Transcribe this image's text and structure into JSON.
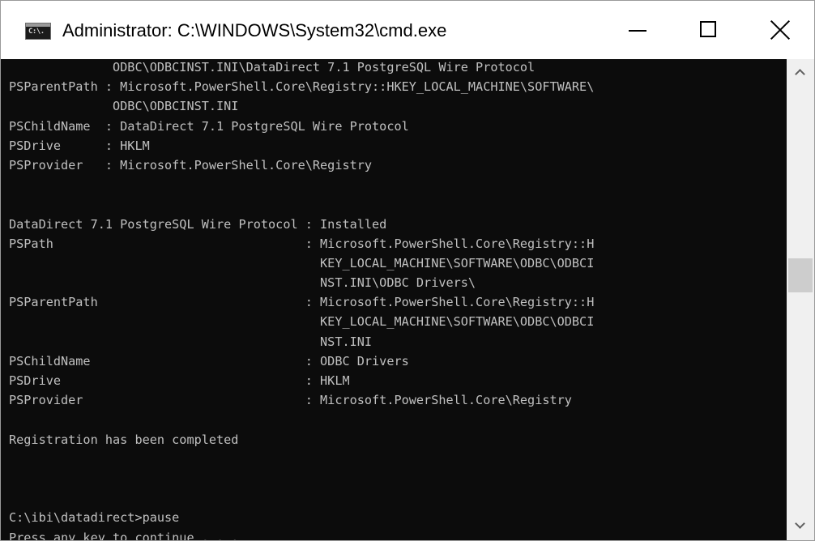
{
  "window": {
    "title": "Administrator: C:\\WINDOWS\\System32\\cmd.exe",
    "icon": "cmd-icon",
    "icon_text": "C:\\.",
    "controls": {
      "minimize": "minimize-icon",
      "maximize": "maximize-icon",
      "close": "close-icon"
    }
  },
  "console": {
    "background": "#0c0c0c",
    "foreground": "#c0c0c0",
    "lines": [
      "              ODBC\\ODBCINST.INI\\DataDirect 7.1 PostgreSQL Wire Protocol",
      "PSParentPath : Microsoft.PowerShell.Core\\Registry::HKEY_LOCAL_MACHINE\\SOFTWARE\\",
      "              ODBC\\ODBCINST.INI",
      "PSChildName  : DataDirect 7.1 PostgreSQL Wire Protocol",
      "PSDrive      : HKLM",
      "PSProvider   : Microsoft.PowerShell.Core\\Registry",
      "",
      "",
      "DataDirect 7.1 PostgreSQL Wire Protocol : Installed",
      "PSPath                                  : Microsoft.PowerShell.Core\\Registry::H",
      "                                          KEY_LOCAL_MACHINE\\SOFTWARE\\ODBC\\ODBCI",
      "                                          NST.INI\\ODBC Drivers\\",
      "PSParentPath                            : Microsoft.PowerShell.Core\\Registry::H",
      "                                          KEY_LOCAL_MACHINE\\SOFTWARE\\ODBC\\ODBCI",
      "                                          NST.INI",
      "PSChildName                             : ODBC Drivers",
      "PSDrive                                 : HKLM",
      "PSProvider                              : Microsoft.PowerShell.Core\\Registry",
      "",
      "Registration has been completed",
      "",
      "",
      "",
      "C:\\ibi\\datadirect>pause",
      "Press any key to continue . . ."
    ]
  },
  "scrollbar": {
    "up": "chevron-up-icon",
    "down": "chevron-down-icon"
  }
}
